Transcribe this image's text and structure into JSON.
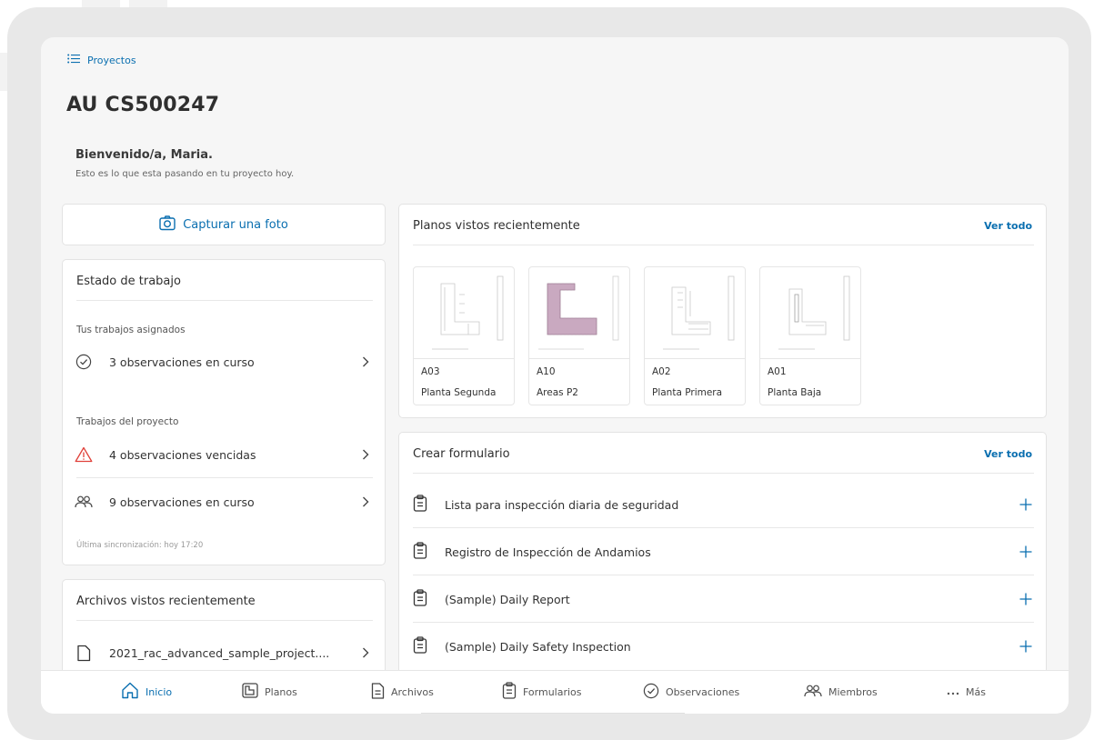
{
  "breadcrumb": {
    "label": "Proyectos"
  },
  "project": {
    "title": "AU CS500247"
  },
  "welcome": {
    "title": "Bienvenido/a, Maria.",
    "subtitle": "Esto es lo que esta pasando en tu proyecto hoy."
  },
  "capture": {
    "label": "Capturar una foto",
    "icon": "camera-icon"
  },
  "estado": {
    "title": "Estado de trabajo",
    "assigned_label": "Tus trabajos asignados",
    "assigned_items": [
      {
        "label": "3 observaciones en curso",
        "icon": "check-circle-icon"
      }
    ],
    "project_label": "Trabajos del proyecto",
    "project_items": [
      {
        "label": "4 observaciones vencidas",
        "icon": "warning-icon"
      },
      {
        "label": "9 observaciones en curso",
        "icon": "people-icon"
      }
    ],
    "sync": "Última sincronización: hoy 17:20"
  },
  "archivos": {
    "title": "Archivos vistos recientemente",
    "items": [
      {
        "label": "2021_rac_advanced_sample_project....",
        "icon": "file-icon"
      }
    ]
  },
  "planos": {
    "title": "Planos vistos recientemente",
    "view_all": "Ver todo",
    "sheets": [
      {
        "code": "A03",
        "name": "Planta Segunda"
      },
      {
        "code": "A10",
        "name": "Areas P2"
      },
      {
        "code": "A02",
        "name": "Planta Primera"
      },
      {
        "code": "A01",
        "name": "Planta Baja"
      }
    ]
  },
  "formulario": {
    "title": "Crear formulario",
    "view_all": "Ver todo",
    "items": [
      {
        "label": "Lista para inspección diaria de seguridad"
      },
      {
        "label": "Registro de Inspección de Andamios"
      },
      {
        "label": "(Sample) Daily Report"
      },
      {
        "label": "(Sample) Daily Safety Inspection"
      }
    ]
  },
  "nav": {
    "items": [
      {
        "label": "Inicio",
        "icon": "home-icon",
        "active": true
      },
      {
        "label": "Planos",
        "icon": "plans-icon"
      },
      {
        "label": "Archivos",
        "icon": "file-icon"
      },
      {
        "label": "Formularios",
        "icon": "clipboard-icon"
      },
      {
        "label": "Observaciones",
        "icon": "check-circle-icon"
      },
      {
        "label": "Miembros",
        "icon": "people-icon"
      },
      {
        "label": "Más",
        "icon": "more-icon"
      }
    ]
  },
  "colors": {
    "accent": "#0a6fb0",
    "warning": "#e0413a",
    "background": "#f6f6f6",
    "card": "#ffffff"
  }
}
